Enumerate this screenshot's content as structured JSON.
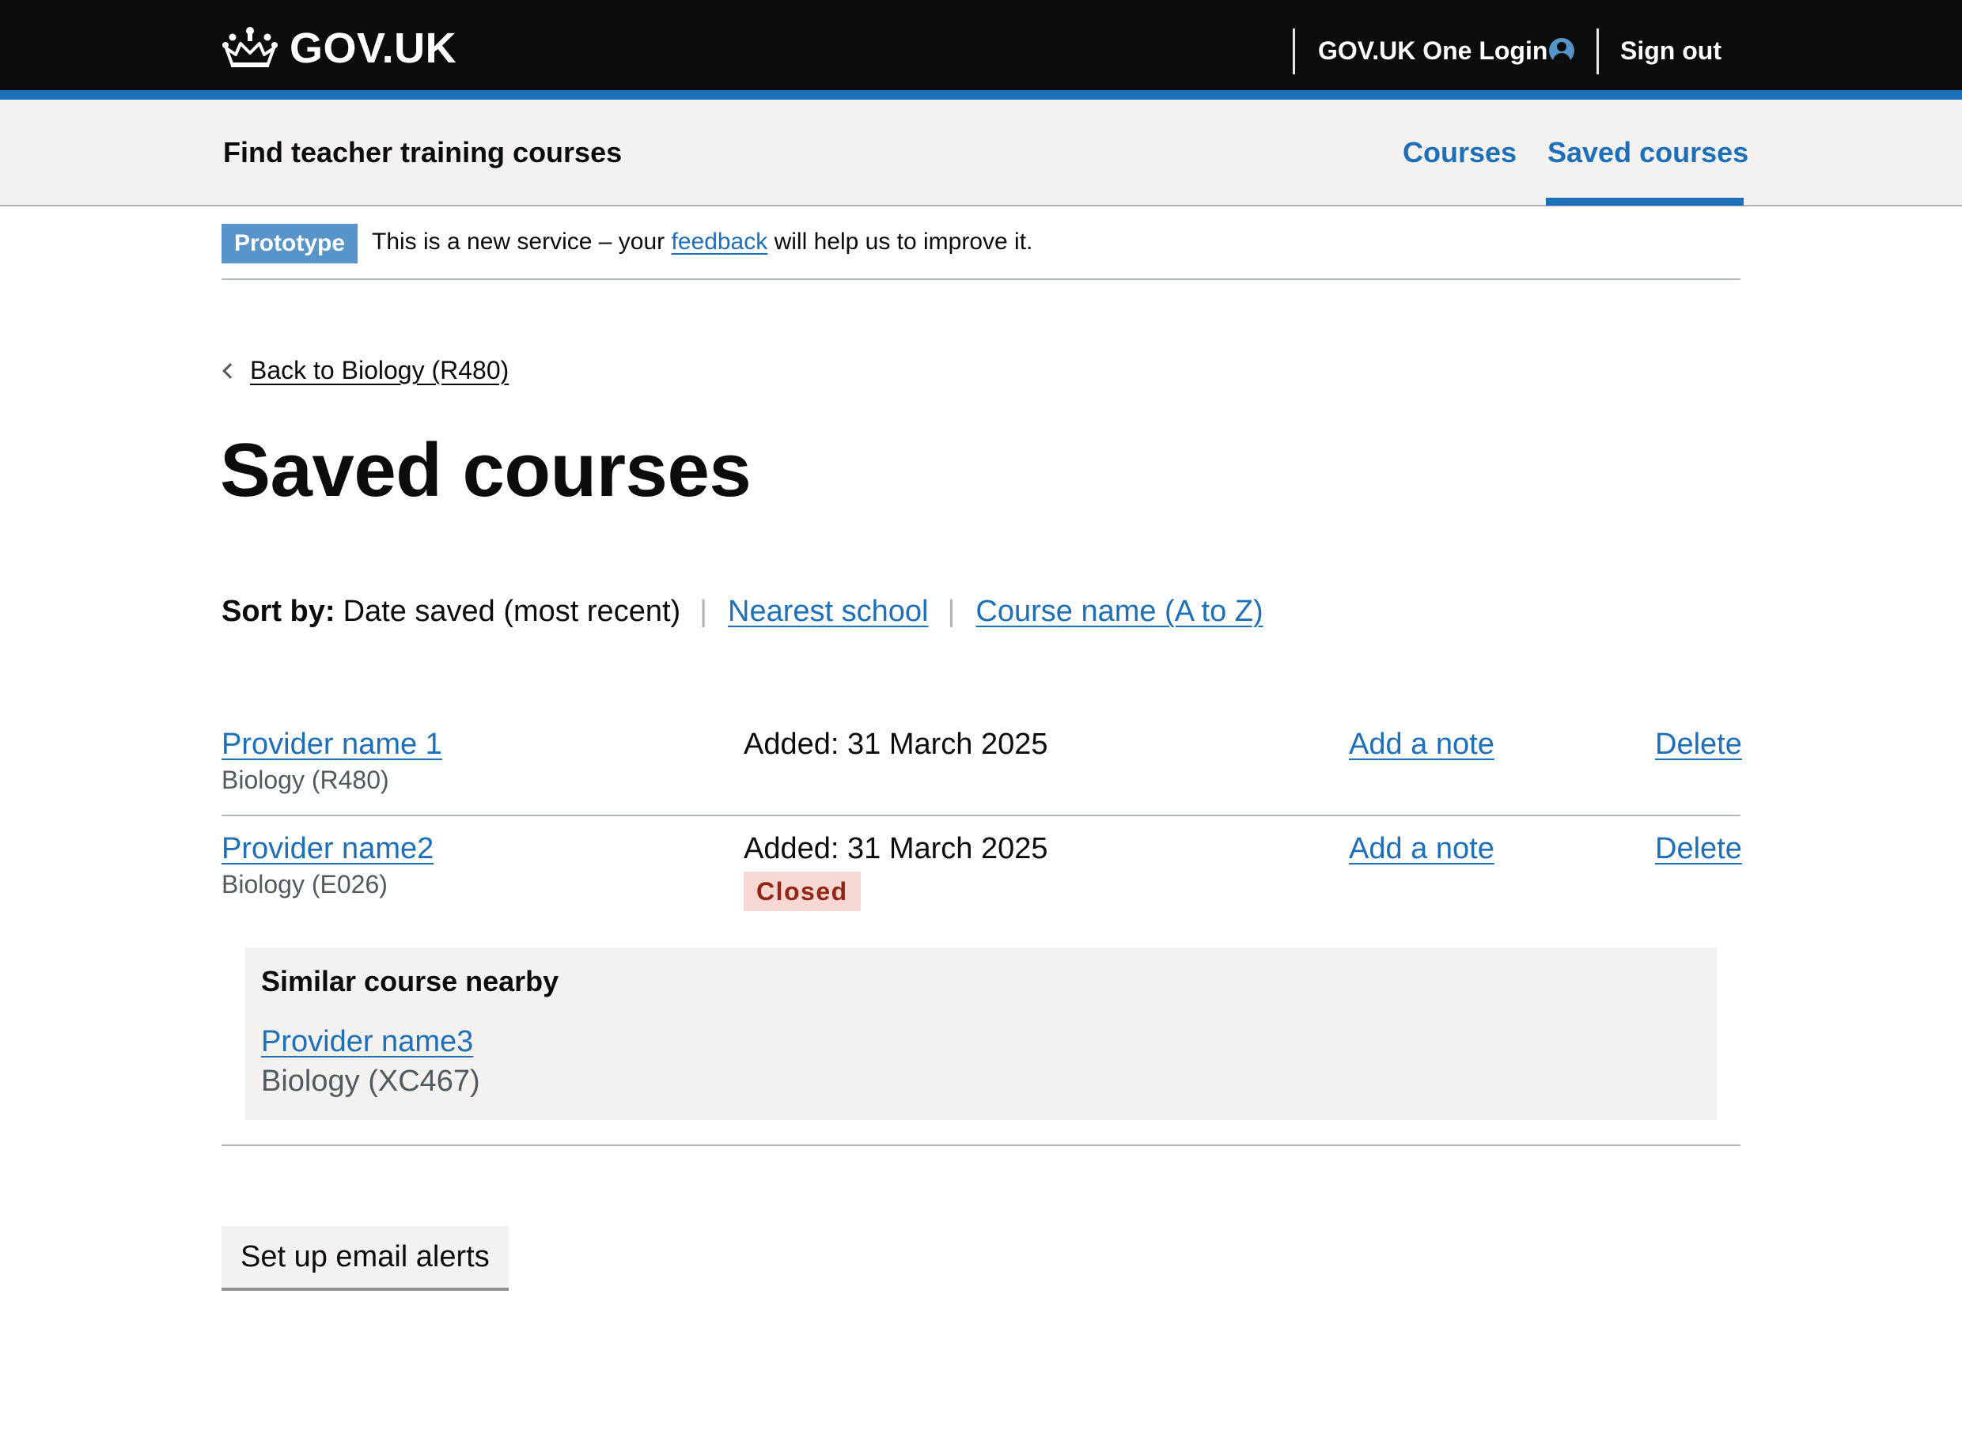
{
  "header": {
    "logotype": "GOV.UK",
    "one_login": "GOV.UK One Login",
    "sign_out": "Sign out",
    "colors": {
      "header_bg": "#0b0c0c",
      "accent_bar": "#1d70b8"
    }
  },
  "service_nav": {
    "service_name": "Find teacher training courses",
    "items": [
      {
        "label": "Courses",
        "active": false
      },
      {
        "label": "Saved courses",
        "active": true
      }
    ]
  },
  "phase_banner": {
    "tag": "Prototype",
    "text_before": "This is a new service – your ",
    "link": "feedback",
    "text_after": " will help us to improve it."
  },
  "back_link": "Back to Biology (R480)",
  "page_title": "Saved courses",
  "sort": {
    "label": "Sort by:",
    "current": "Date saved (most recent)",
    "separator": "|",
    "options": [
      "Nearest school",
      "Course name (A to Z)"
    ]
  },
  "courses": [
    {
      "provider": "Provider name 1",
      "course": "Biology (R480)",
      "added": "Added: 31 March 2025",
      "add_note": "Add a note",
      "delete": "Delete"
    },
    {
      "provider": "Provider name2",
      "course": "Biology (E026)",
      "added": "Added: 31 March 2025",
      "status": "Closed",
      "add_note": "Add a note",
      "delete": "Delete",
      "similar": {
        "heading": "Similar course nearby",
        "provider": "Provider name3",
        "course": "Biology (XC467)"
      }
    }
  ],
  "email_alerts_button": "Set up email alerts"
}
